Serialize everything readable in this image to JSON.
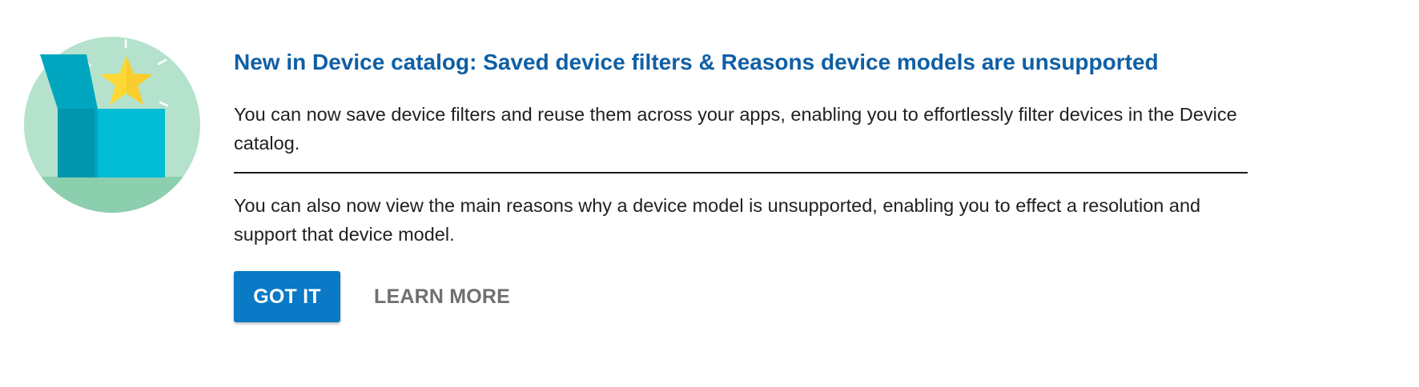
{
  "announcement": {
    "title": "New in Device catalog: Saved device filters & Reasons device models are unsupported",
    "paragraph_1": "You can now save device filters and reuse them across your apps, enabling you to effortlessly filter devices in the Device catalog.",
    "paragraph_2": "You can also now view the main reasons why a device model is unsupported, enabling you to effect a resolution and support that device model."
  },
  "actions": {
    "primary_label": "GOT IT",
    "secondary_label": "LEARN MORE"
  },
  "illustration": {
    "icon": "open-box-star-icon",
    "colors": {
      "circle": "#b5e2cc",
      "ground": "#8ccfae",
      "box": "#00bcd4",
      "box_dark": "#00a6c0",
      "star": "#fdd835"
    }
  },
  "colors": {
    "title": "#0f5fa5",
    "primary_button": "#0a79c6",
    "secondary_button_text": "#6f6f6f",
    "body_text": "#212121"
  }
}
